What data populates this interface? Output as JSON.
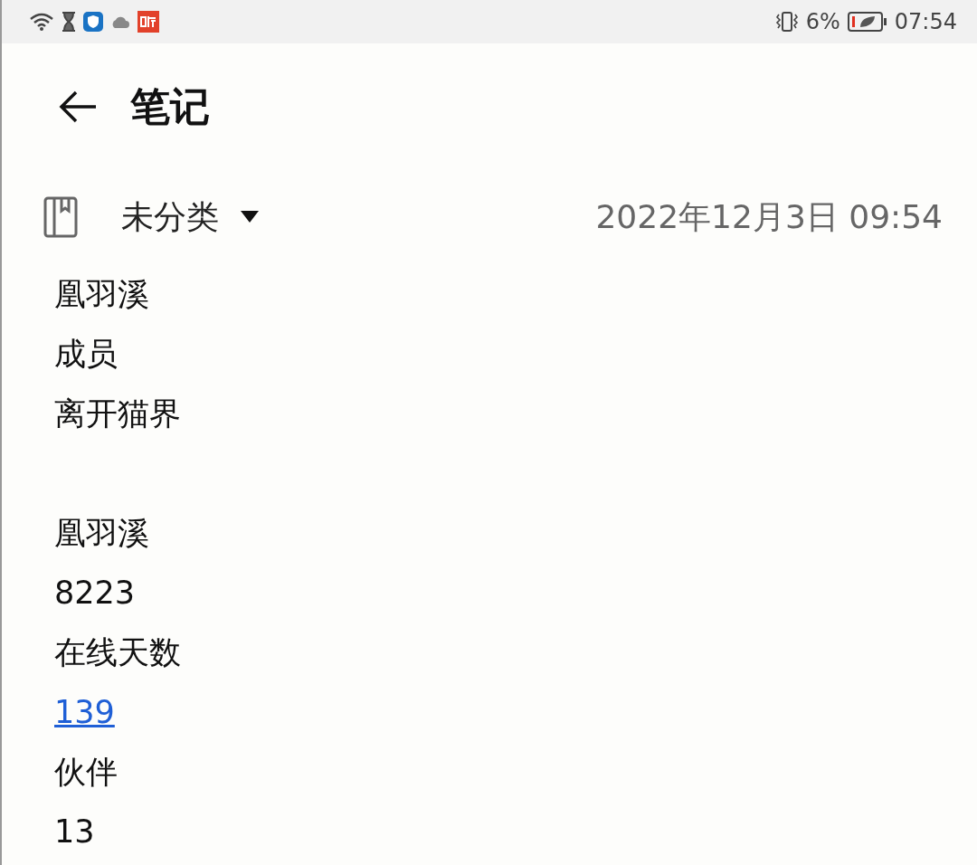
{
  "status_bar": {
    "battery_percent": "6%",
    "time": "07:54"
  },
  "header": {
    "title": "笔记"
  },
  "meta": {
    "category": "未分类",
    "date": "2022年12月3日 09:54"
  },
  "lines": [
    {
      "kind": "text",
      "text": "凰羽溪"
    },
    {
      "kind": "text",
      "text": "成员"
    },
    {
      "kind": "text",
      "text": "离开猫界"
    },
    {
      "kind": "blank"
    },
    {
      "kind": "text",
      "text": "凰羽溪"
    },
    {
      "kind": "text",
      "text": "8223"
    },
    {
      "kind": "text",
      "text": "在线天数"
    },
    {
      "kind": "link",
      "text": "139"
    },
    {
      "kind": "text",
      "text": "伙伴"
    },
    {
      "kind": "text",
      "text": "13"
    }
  ]
}
